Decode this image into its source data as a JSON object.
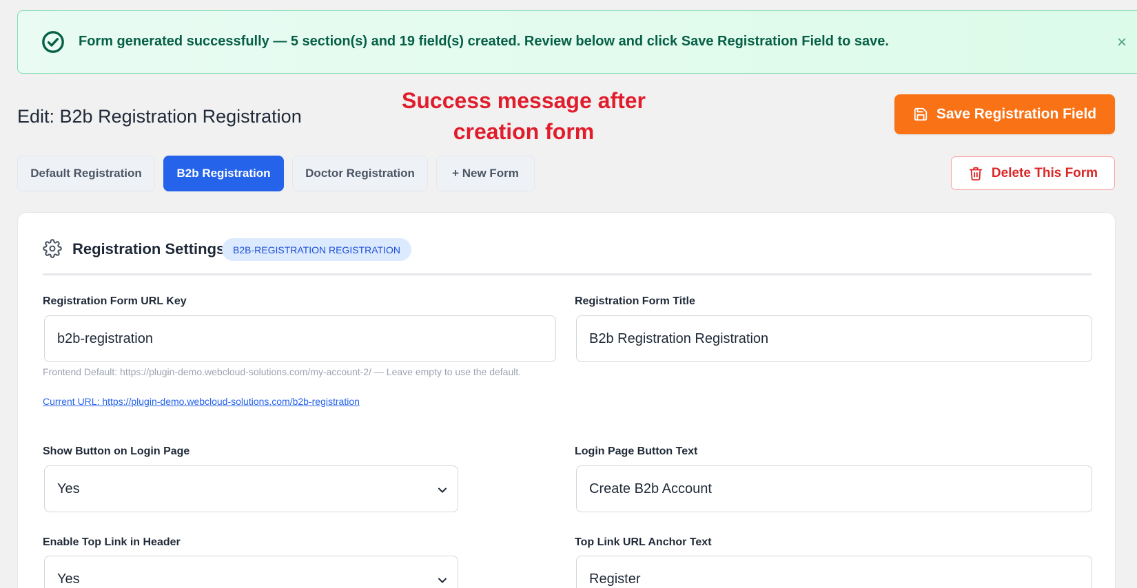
{
  "notice": {
    "message": "Form generated successfully — 5 section(s) and 19 field(s) created. Review below and click Save Registration Field to save.",
    "close_symbol": "×",
    "icon": "check-circle-icon"
  },
  "header": {
    "title": "Edit: B2b Registration Registration",
    "annotation_line1": "Success message after",
    "annotation_line2": "creation form",
    "save_label": "Save Registration Field",
    "delete_label": "Delete This Form"
  },
  "tabs": [
    {
      "label": "Default Registration",
      "active": false
    },
    {
      "label": "B2b Registration",
      "active": true
    },
    {
      "label": "Doctor Registration",
      "active": false
    },
    {
      "label": "+ New Form",
      "active": false
    }
  ],
  "card": {
    "title": "Registration Settings",
    "badge": "B2B-REGISTRATION REGISTRATION",
    "fields": {
      "url_key": {
        "label": "Registration Form URL Key",
        "value": "b2b-registration",
        "help": "Frontend Default: https://plugin-demo.webcloud-solutions.com/my-account-2/ — Leave empty to use the default.",
        "current_url": "Current URL: https://plugin-demo.webcloud-solutions.com/b2b-registration"
      },
      "form_title": {
        "label": "Registration Form Title",
        "value": "B2b Registration Registration"
      },
      "show_button": {
        "label": "Show Button on Login Page",
        "value": "Yes"
      },
      "button_text": {
        "label": "Login Page Button Text",
        "value": "Create B2b Account"
      },
      "top_link": {
        "label": "Enable Top Link in Header",
        "value": "Yes"
      },
      "anchor_text": {
        "label": "Top Link URL Anchor Text",
        "value": "Register"
      }
    }
  },
  "colors": {
    "accent_blue": "#2563eb",
    "save_orange": "#f97316",
    "danger_red": "#dc2626",
    "success_green": "#065f46",
    "annotation_red": "#e11d2c"
  }
}
